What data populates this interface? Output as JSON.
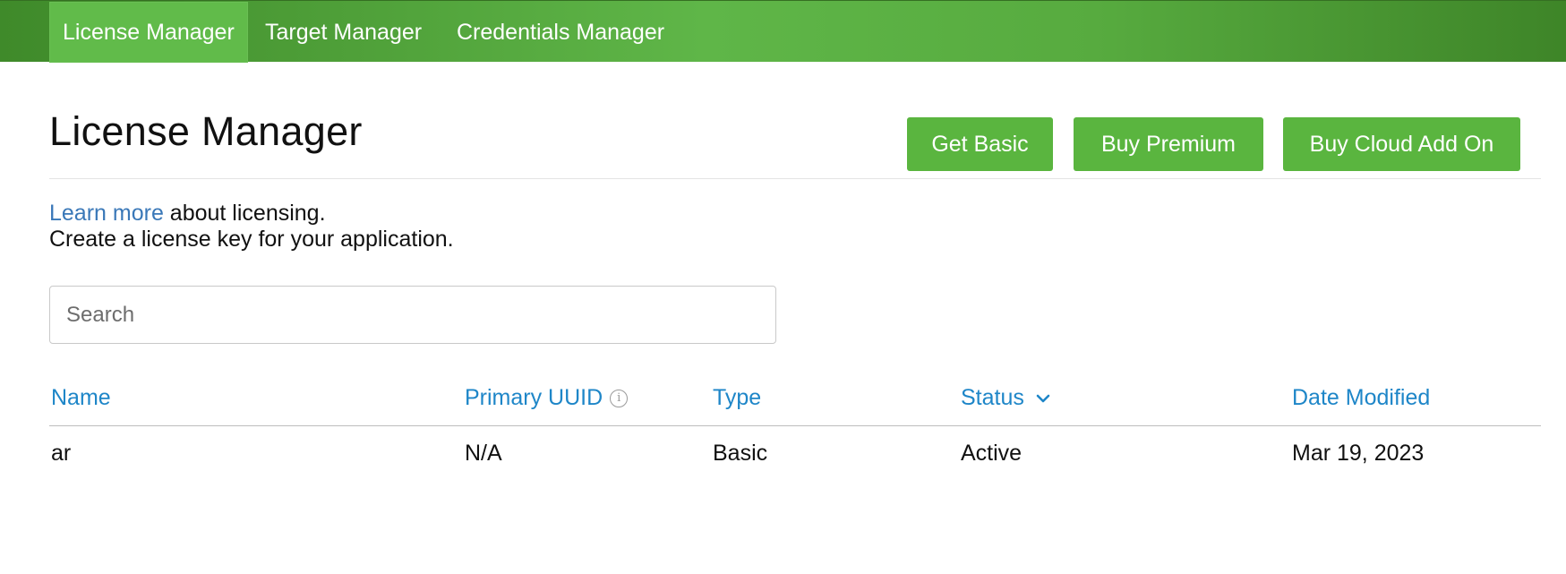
{
  "nav": {
    "tabs": [
      {
        "label": "License Manager",
        "active": true
      },
      {
        "label": "Target Manager",
        "active": false
      },
      {
        "label": "Credentials Manager",
        "active": false
      }
    ]
  },
  "header": {
    "title": "License Manager",
    "buttons": {
      "get_basic": "Get Basic",
      "buy_premium": "Buy Premium",
      "buy_cloud_add_on": "Buy Cloud Add On"
    }
  },
  "intro": {
    "link_text": "Learn more",
    "link_suffix": " about licensing.",
    "line2": "Create a license key for your application."
  },
  "search": {
    "placeholder": "Search",
    "value": ""
  },
  "table": {
    "columns": {
      "name": "Name",
      "primary_uuid": "Primary UUID",
      "type": "Type",
      "status": "Status",
      "date_modified": "Date Modified"
    },
    "sort": {
      "column": "Status",
      "direction": "descending"
    },
    "rows": [
      {
        "name": "ar",
        "primary_uuid": "N/A",
        "type": "Basic",
        "status": "Active",
        "date_modified": "Mar 19, 2023"
      }
    ]
  },
  "colors": {
    "brand_green": "#5ab53f",
    "link_blue": "#3a78b8",
    "header_blue": "#1e86c8"
  },
  "icons": {
    "primary_uuid_info": "info-icon",
    "status_sort": "chevron-down-icon"
  }
}
